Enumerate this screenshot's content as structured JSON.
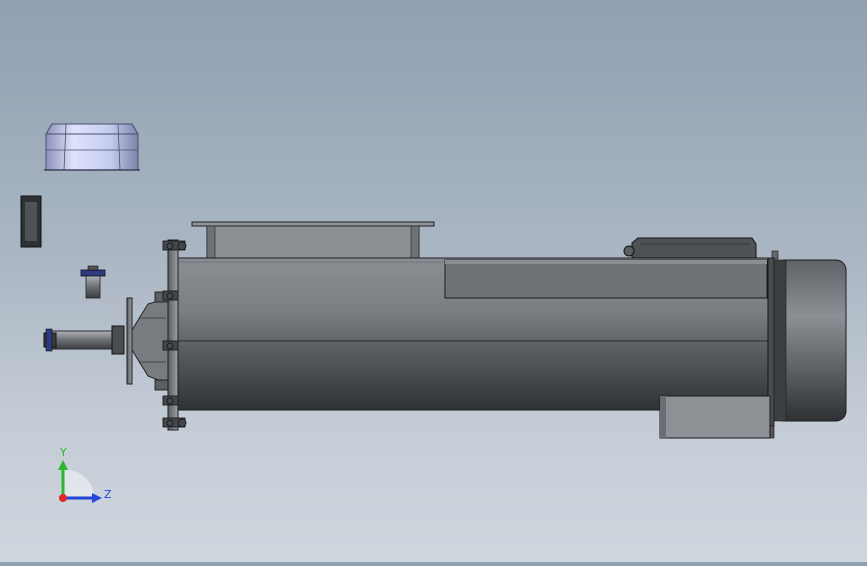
{
  "viewport": {
    "background_top": "#8fa0b1",
    "background_bottom": "#cfd6de"
  },
  "model": {
    "parts": [
      "cap-part",
      "bracket-part",
      "bolt-part",
      "drive-shaft",
      "front-flange",
      "housing-body",
      "top-inlet-hopper",
      "top-cover-plate",
      "control-box",
      "motor-cylinder",
      "motor-base-block"
    ],
    "colors": {
      "steel_dark": "#3e4246",
      "steel_mid": "#6f7378",
      "steel_light": "#9ea3a8",
      "cap_blue": "#c9cff2",
      "outline": "#1a1c1e"
    }
  },
  "triad": {
    "y_label": "Y",
    "z_label": "Z",
    "x_color": "#e0262b",
    "y_color": "#2fb52f",
    "z_color": "#2347d6"
  }
}
